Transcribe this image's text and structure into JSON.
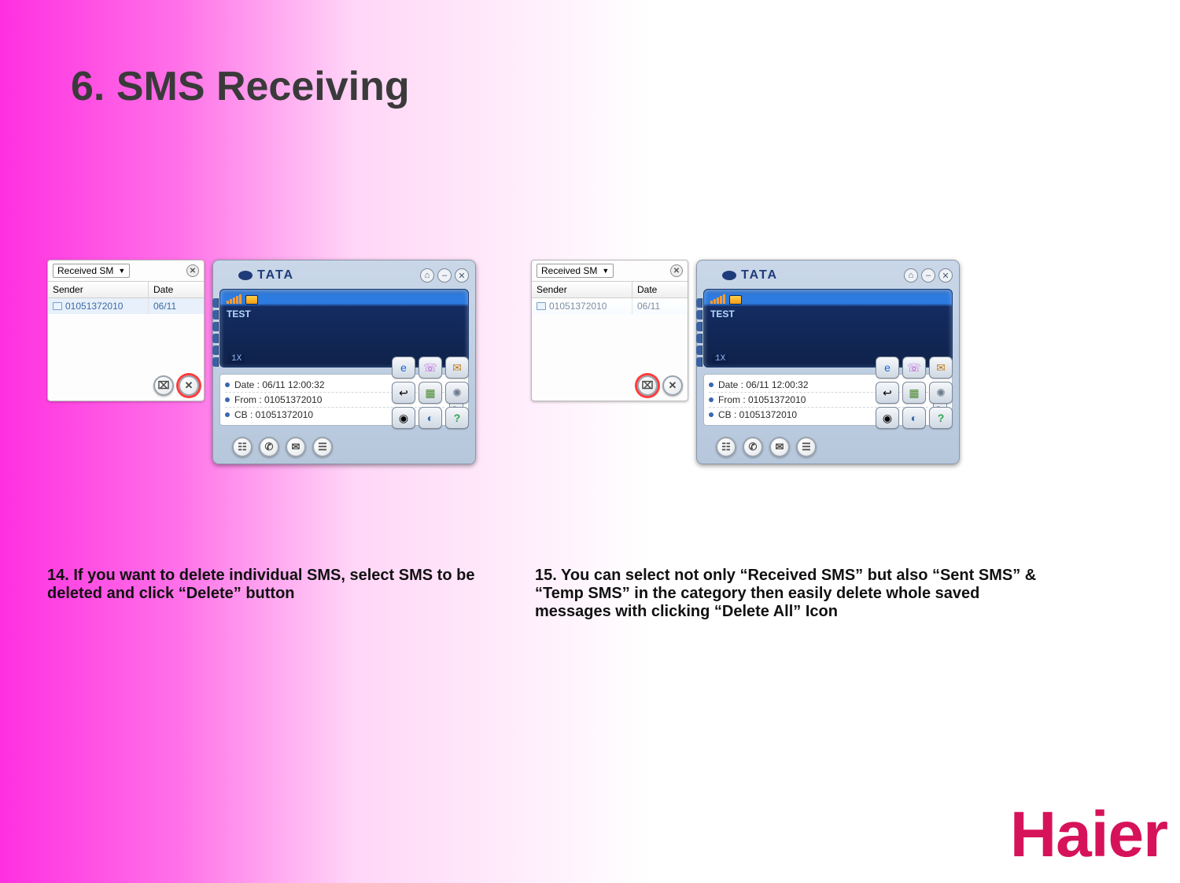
{
  "title": "6. SMS Receiving",
  "logo": "Haier",
  "sms_list": {
    "dropdown": "Received SM",
    "headers": {
      "sender": "Sender",
      "date": "Date"
    },
    "row": {
      "sender": "01051372010",
      "date": "06/11"
    }
  },
  "tata": {
    "brand": "TATA",
    "screen_label": "TEST",
    "network": "1X",
    "info_date": "Date : 06/11 12:00:32",
    "info_from": "From : 01051372010",
    "info_cb": "CB : 01051372010"
  },
  "captions": {
    "left": "14. If you want to delete individual SMS, select SMS to be deleted and click “Delete” button",
    "right": "15. You can select not only “Received SMS” but also “Sent SMS” & “Temp SMS” in the category then easily delete whole saved messages with clicking “Delete All” Icon"
  }
}
